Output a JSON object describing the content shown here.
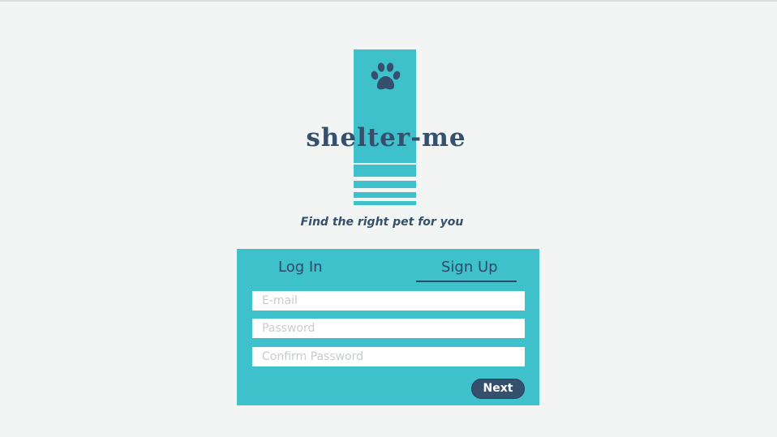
{
  "brand": {
    "name": "shelter-me",
    "tagline": "Find the right pet for you",
    "accent_color": "#3fc1cb",
    "text_color": "#35506d",
    "logo_icon": "paw-icon"
  },
  "auth": {
    "tabs": [
      {
        "label": "Log In",
        "active": false
      },
      {
        "label": "Sign Up",
        "active": true
      }
    ],
    "fields": {
      "email_placeholder": "E-mail",
      "password_placeholder": "Password",
      "confirm_password_placeholder": "Confirm Password"
    },
    "next_label": "Next"
  }
}
